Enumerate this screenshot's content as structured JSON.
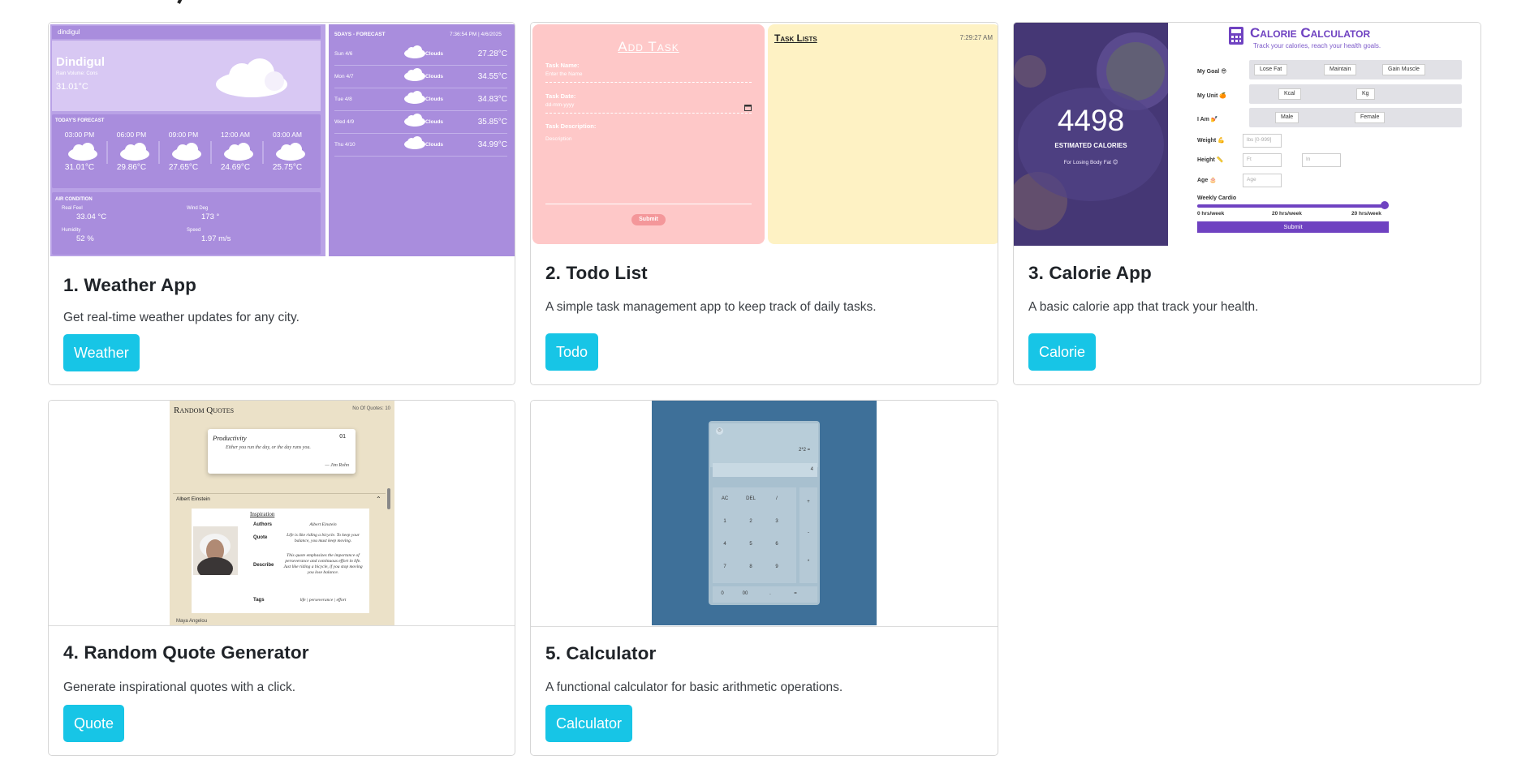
{
  "cards": [
    {
      "title": "1. Weather App",
      "text": "Get real-time weather updates for any city.",
      "button": "Weather",
      "preview": {
        "city_bar": "dindigul",
        "city": "Dindigul",
        "sub": "Rain Volume: Cons",
        "temp": "31.01°C",
        "today_title": "TODAY'S FORECAST",
        "hours": [
          {
            "time": "03:00 PM",
            "temp": "31.01°C"
          },
          {
            "time": "06:00 PM",
            "temp": "29.86°C"
          },
          {
            "time": "09:00 PM",
            "temp": "27.65°C"
          },
          {
            "time": "12:00 AM",
            "temp": "24.69°C"
          },
          {
            "time": "03:00 AM",
            "temp": "25.75°C"
          }
        ],
        "air_title": "AIR CONDITION",
        "air": [
          {
            "label": "Real Feel",
            "value": "33.04 °C"
          },
          {
            "label": "Wind Deg",
            "value": "173 °"
          },
          {
            "label": "Humidity",
            "value": "52 %"
          },
          {
            "label": "Speed",
            "value": "1.97 m/s"
          }
        ],
        "forecast_title": "5DAYS - FORECAST",
        "forecast_time": "7:36:54 PM | 4/6/2025",
        "forecast": [
          {
            "day": "Sun 4/6",
            "cond": "Clouds",
            "temp": "27.28°C"
          },
          {
            "day": "Mon 4/7",
            "cond": "Clouds",
            "temp": "34.55°C"
          },
          {
            "day": "Tue 4/8",
            "cond": "Clouds",
            "temp": "34.83°C"
          },
          {
            "day": "Wed 4/9",
            "cond": "Clouds",
            "temp": "35.85°C"
          },
          {
            "day": "Thu 4/10",
            "cond": "Clouds",
            "temp": "34.99°C"
          }
        ]
      }
    },
    {
      "title": "2. Todo List",
      "text": "A simple task management app to keep track of daily tasks.",
      "button": "Todo",
      "preview": {
        "add_title": "Add Task",
        "name_label": "Task Name:",
        "name_placeholder": "Enter the Name",
        "date_label": "Task Date:",
        "date_placeholder": "dd-mm-yyyy",
        "desc_label": "Task Description:",
        "desc_placeholder": "Description",
        "submit": "Submit",
        "lists_title": "Task Lists",
        "time": "7:29:27 AM"
      }
    },
    {
      "title": "3. Calorie App",
      "text": "A basic calorie app that track your health.",
      "button": "Calorie",
      "preview": {
        "calories": "4498",
        "estimated": "ESTIMATED CALORIES",
        "goal_note": "For Losing Body Fat 😊",
        "app_title": "Calorie Calculator",
        "tagline": "Track your calories, reach your health goals.",
        "goal_label": "My Goal 😎",
        "goals": [
          "Lose Fat",
          "Maintain",
          "Gain Muscle"
        ],
        "unit_label": "My Unit 🍊",
        "units": [
          "Kcal",
          "Kg"
        ],
        "iam_label": "I Am 💅",
        "genders": [
          "Male",
          "Female"
        ],
        "weight_label": "Weight 💪",
        "weight_placeholder": "lbs [0-999]",
        "height_label": "Height 📏",
        "height_ft": "Ft",
        "height_in": "In",
        "age_label": "Age 🎂",
        "age_placeholder": "Age",
        "cardio_label": "Weekly Cardio",
        "cardio_levels": [
          "0 hrs/week",
          "20 hrs/week",
          "20 hrs/week"
        ],
        "cardio_value": 0.98,
        "submit": "Submit"
      }
    },
    {
      "title": "4. Random Quote Generator",
      "text": "Generate inspirational quotes with a click.",
      "button": "Quote",
      "preview": {
        "head": "Random Quotes",
        "count": "No Of Quotes: 10",
        "card_label": "Productivity",
        "card_num": "01",
        "card_quote": "Either you run the day, or the day runs you.",
        "card_author": "— Jim Rohn",
        "accordion": "Albert Einstein",
        "sub": "Inspiration",
        "rows": [
          {
            "key": "Authors",
            "value": "Albert Einstein"
          },
          {
            "key": "Quote",
            "value": "Life is like riding a bicycle. To keep your balance, you must keep moving."
          },
          {
            "key": "Describe",
            "value": "This quote emphasizes the importance of perseverance and continuous effort in life. Just like riding a bicycle, if you stop moving you lose balance."
          },
          {
            "key": "Tags",
            "value": "life | perseverance | effort"
          }
        ],
        "footer": "Maya Angelou"
      }
    },
    {
      "title": "5. Calculator",
      "text": "A functional calculator for basic arithmetic operations.",
      "button": "Calculator",
      "preview": {
        "expr": "2*2 =",
        "result": "4",
        "keys": [
          "AC",
          "DEL",
          "/",
          "1",
          "2",
          "3",
          "4",
          "5",
          "6",
          "7",
          "8",
          "9"
        ],
        "ops": [
          "+",
          "-",
          "*"
        ],
        "bottom": [
          "0",
          "00",
          ".",
          "="
        ]
      }
    }
  ],
  "colors": {
    "button_bg": "#17c5e6",
    "button_text": "#ffffff",
    "weather_bg": "#b9a2e6",
    "todo_add": "#fec8c8",
    "todo_list": "#fef2c4",
    "calorie_accent": "#6f42c1",
    "quote_bg": "#ebe1c8",
    "calculator_bg": "#3e7099"
  }
}
